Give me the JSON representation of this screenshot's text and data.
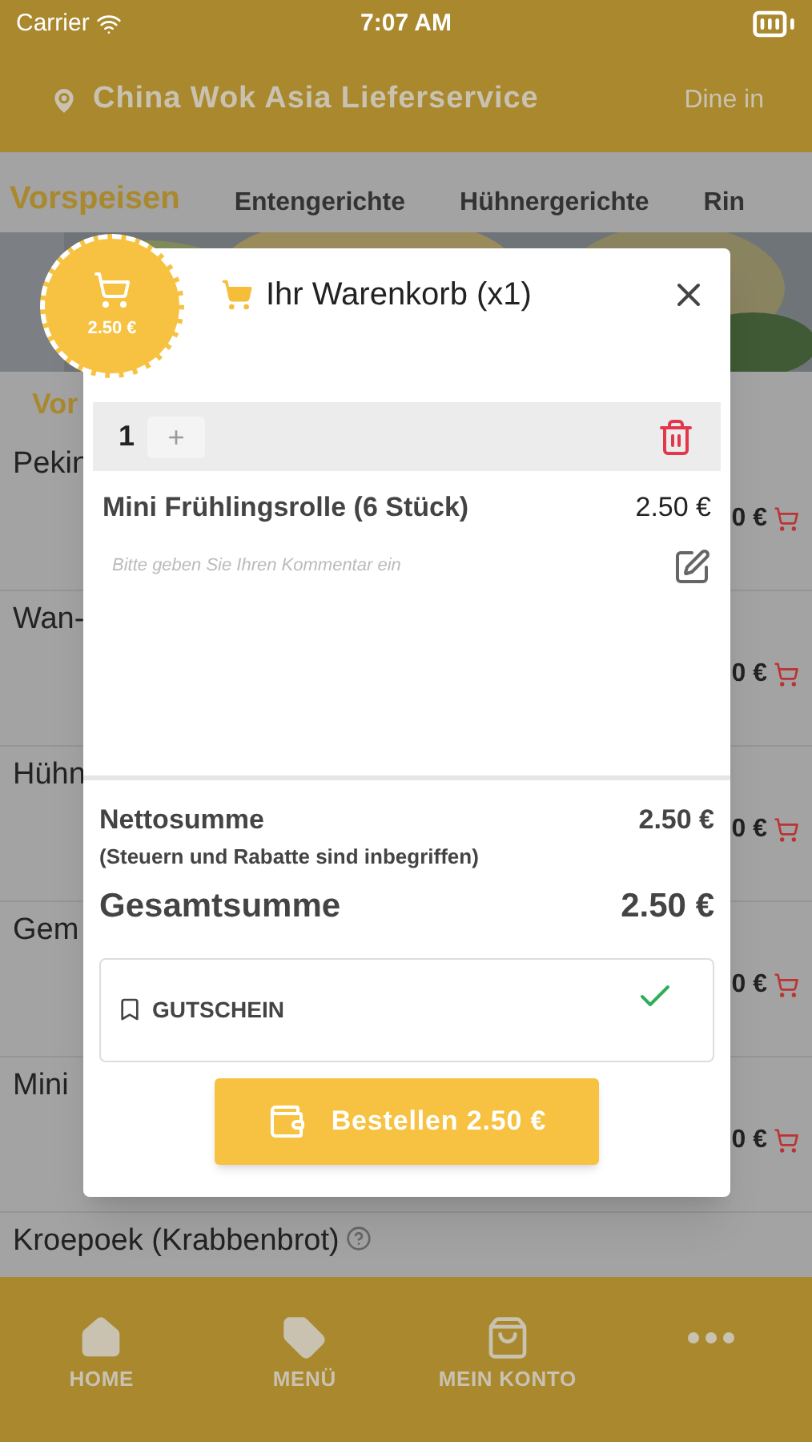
{
  "status_bar": {
    "carrier": "Carrier",
    "time": "7:07 AM"
  },
  "header": {
    "title": "China Wok Asia Lieferservice",
    "mode": "Dine in"
  },
  "categories": [
    {
      "label": "Vorspeisen",
      "selected": true
    },
    {
      "label": "Entengerichte",
      "selected": false
    },
    {
      "label": "Hühnergerichte",
      "selected": false
    },
    {
      "label": "Rin",
      "selected": false
    }
  ],
  "section_title": "Vor",
  "items": [
    {
      "name": "Pekin",
      "price": "0 €"
    },
    {
      "name": "Wan-",
      "price": "0 €"
    },
    {
      "name": "Hühn",
      "price": "0 €"
    },
    {
      "name": "Gem",
      "price": "0 €"
    },
    {
      "name": "Mini",
      "price": "0 €"
    },
    {
      "name": "Kroepoek (Krabbenbrot)",
      "info": true
    }
  ],
  "cart_badge": {
    "total": "2.50 €"
  },
  "cart": {
    "title": "Ihr Warenkorb (x1)",
    "lines": [
      {
        "quantity": "1",
        "plus": "+",
        "name": "Mini Frühlingsrolle (6 Stück)",
        "price": "2.50 €",
        "comment_placeholder": "Bitte geben Sie Ihren Kommentar ein"
      }
    ],
    "net_label": "Nettosumme",
    "net_note": "(Steuern und Rabatte sind inbegriffen)",
    "net_value": "2.50 €",
    "total_label": "Gesamtsumme",
    "total_value": "2.50 €",
    "voucher": {
      "label": "GUTSCHEIN",
      "applied": true
    },
    "order_button": "Bestellen 2.50 €"
  },
  "nav": [
    {
      "kind": "home",
      "label": "HOME"
    },
    {
      "kind": "tag",
      "label": "MENÜ"
    },
    {
      "kind": "bag",
      "label": "MEIN KONTO"
    },
    {
      "kind": "more"
    }
  ]
}
